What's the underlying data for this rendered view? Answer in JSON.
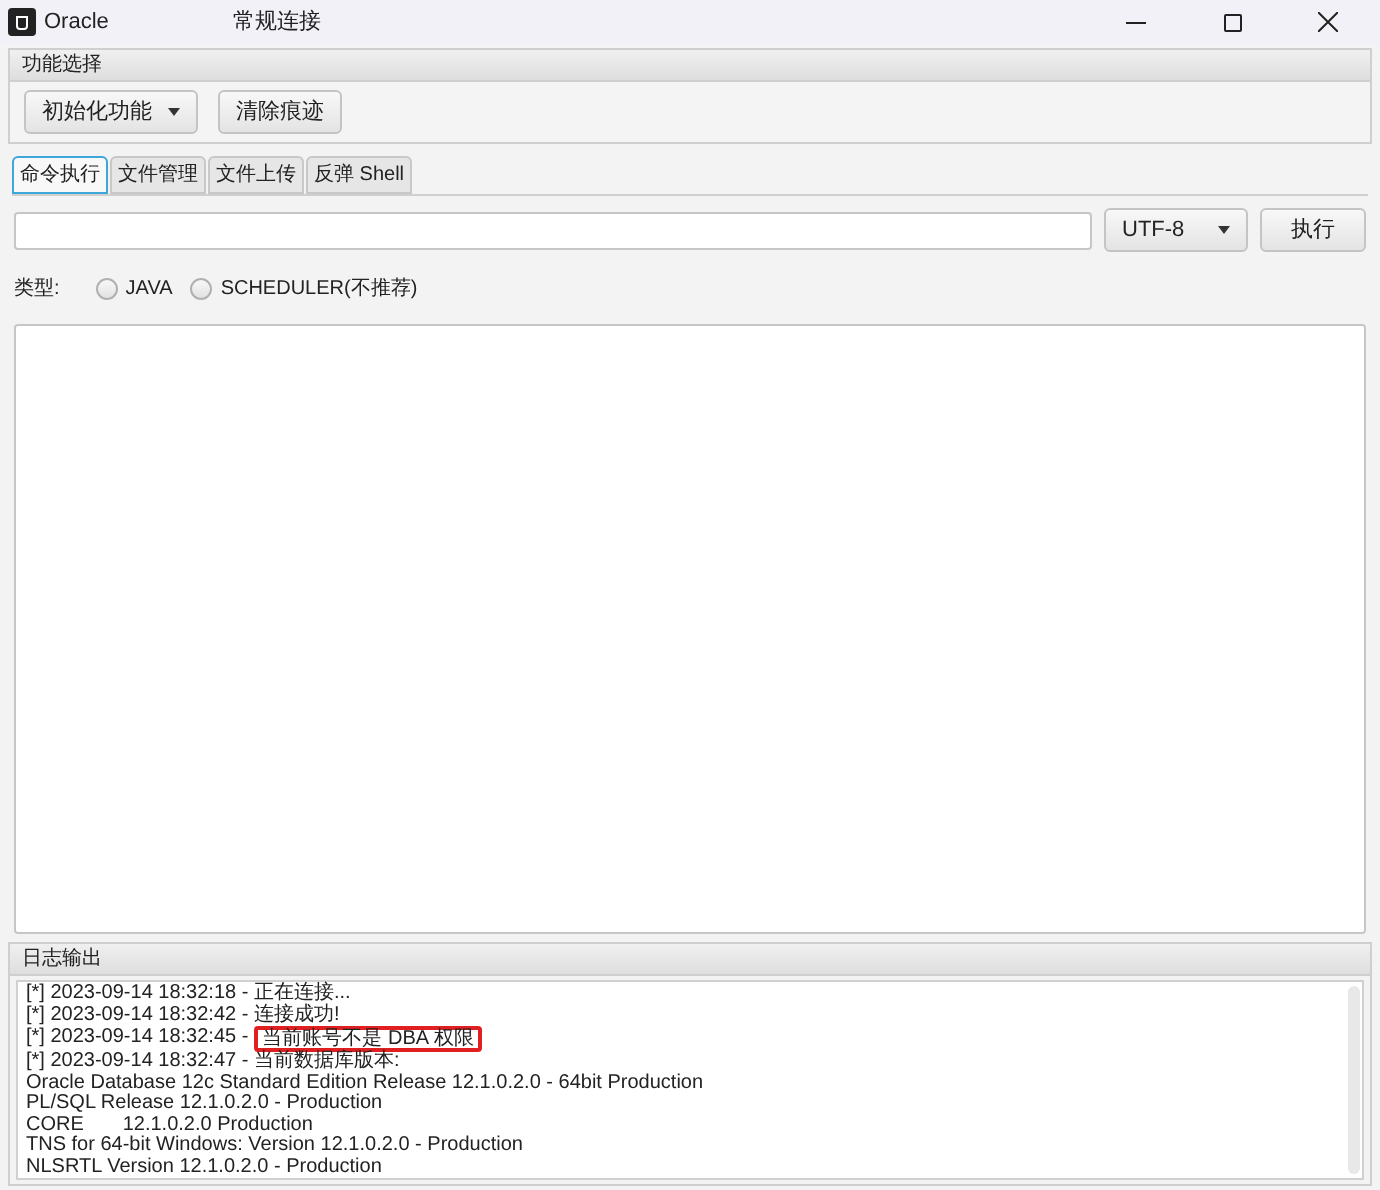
{
  "window": {
    "app_name": "Oracle",
    "title": "常规连接"
  },
  "function_panel": {
    "title": "功能选择",
    "buttons": [
      {
        "label": "初始化功能",
        "kind": "dropdown"
      },
      {
        "label": "清除痕迹",
        "kind": "plain"
      }
    ]
  },
  "tabs": [
    {
      "label": "命令执行",
      "selected": true
    },
    {
      "label": "文件管理",
      "selected": false
    },
    {
      "label": "文件上传",
      "selected": false
    },
    {
      "label": "反弹 Shell",
      "selected": false
    }
  ],
  "command": {
    "encoding": "UTF-8",
    "run_button": "执行"
  },
  "type_row": {
    "label": "类型:",
    "options": [
      {
        "label": "JAVA",
        "selected": false
      },
      {
        "label": "SCHEDULER(不推荐)",
        "selected": false
      }
    ]
  },
  "log": {
    "title": "日志输出",
    "lines": [
      {
        "text": "[*] 2023-09-14 18:32:18 - 正在连接..."
      },
      {
        "text": "[*] 2023-09-14 18:32:42 - 连接成功!"
      },
      {
        "text": "[*] 2023-09-14 18:32:45 -",
        "marked": "当前账号不是 DBA 权限"
      },
      {
        "text": "[*] 2023-09-14 18:32:47 - 当前数据库版本:"
      },
      {
        "text": "Oracle Database 12c Standard Edition Release 12.1.0.2.0 - 64bit Production"
      },
      {
        "text": "PL/SQL Release 12.1.0.2.0 - Production"
      },
      {
        "text": "CORE       12.1.0.2.0 Production"
      },
      {
        "text": "TNS for 64-bit Windows: Version 12.1.0.2.0 - Production"
      },
      {
        "text": "NLSRTL Version 12.1.0.2.0 - Production"
      }
    ]
  }
}
